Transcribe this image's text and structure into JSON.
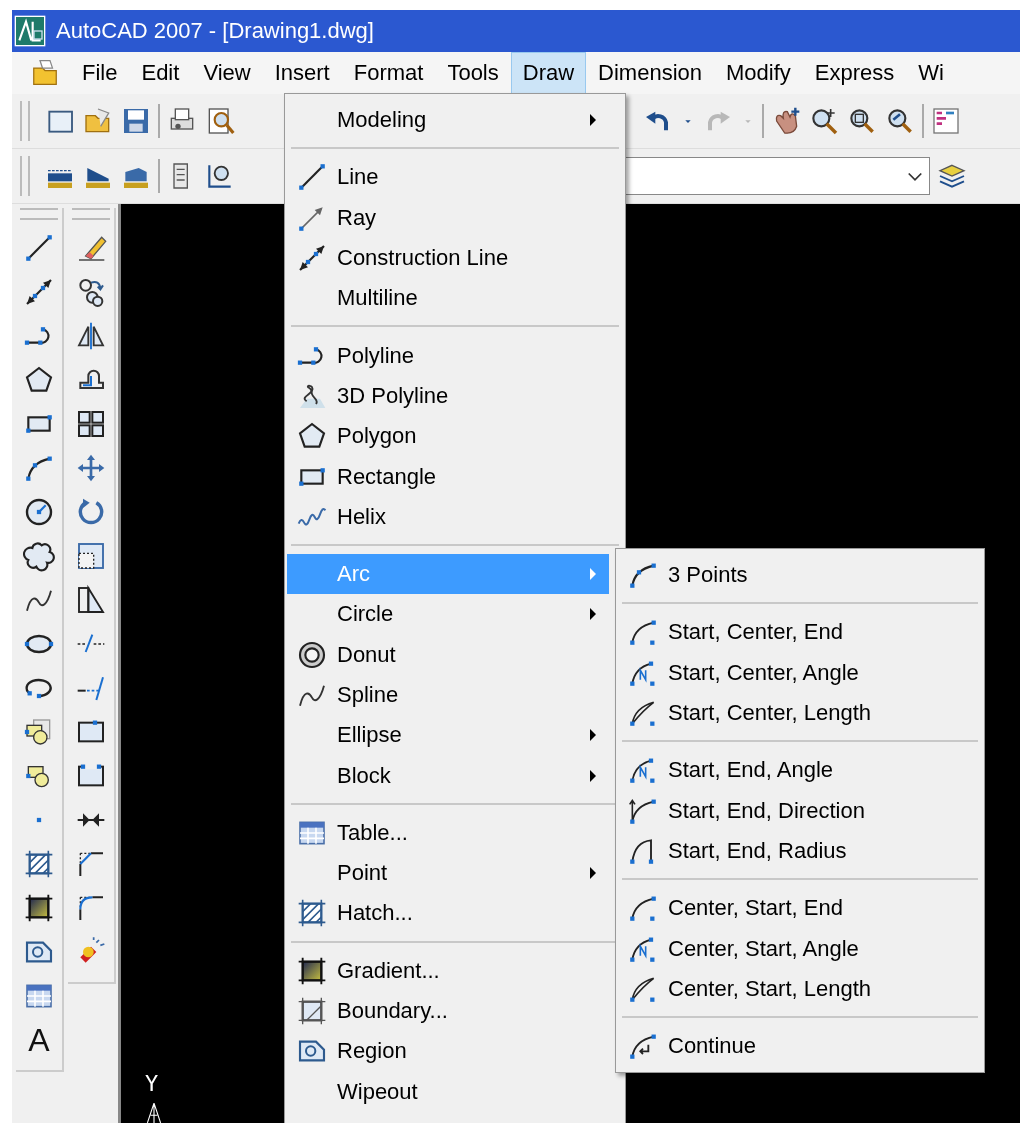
{
  "window": {
    "title": "AutoCAD 2007 - [Drawing1.dwg]"
  },
  "menubar": [
    {
      "label": "File",
      "selected": false
    },
    {
      "label": "Edit",
      "selected": false
    },
    {
      "label": "View",
      "selected": false
    },
    {
      "label": "Insert",
      "selected": false
    },
    {
      "label": "Format",
      "selected": false
    },
    {
      "label": "Tools",
      "selected": false
    },
    {
      "label": "Draw",
      "selected": true
    },
    {
      "label": "Dimension",
      "selected": false
    },
    {
      "label": "Modify",
      "selected": false
    },
    {
      "label": "Express",
      "selected": false
    },
    {
      "label": "Wi",
      "selected": false
    }
  ],
  "draw_toolbar": {
    "text_tool_glyph": "A"
  },
  "ucs_icon": {
    "y_label": "Y"
  },
  "draw_menu": {
    "sections": [
      [
        {
          "label": "Modeling",
          "submenu": true,
          "selected": false
        }
      ],
      [
        {
          "label": "Line",
          "submenu": false,
          "selected": false
        },
        {
          "label": "Ray",
          "submenu": false,
          "selected": false
        },
        {
          "label": "Construction Line",
          "submenu": false,
          "selected": false
        },
        {
          "label": "Multiline",
          "submenu": false,
          "selected": false
        }
      ],
      [
        {
          "label": "Polyline",
          "submenu": false,
          "selected": false
        },
        {
          "label": "3D Polyline",
          "submenu": false,
          "selected": false
        },
        {
          "label": "Polygon",
          "submenu": false,
          "selected": false
        },
        {
          "label": "Rectangle",
          "submenu": false,
          "selected": false
        },
        {
          "label": "Helix",
          "submenu": false,
          "selected": false
        }
      ],
      [
        {
          "label": "Arc",
          "submenu": true,
          "selected": true
        },
        {
          "label": "Circle",
          "submenu": true,
          "selected": false
        },
        {
          "label": "Donut",
          "submenu": false,
          "selected": false
        },
        {
          "label": "Spline",
          "submenu": false,
          "selected": false
        },
        {
          "label": "Ellipse",
          "submenu": true,
          "selected": false
        },
        {
          "label": "Block",
          "submenu": true,
          "selected": false
        }
      ],
      [
        {
          "label": "Table...",
          "submenu": false,
          "selected": false
        },
        {
          "label": "Point",
          "submenu": true,
          "selected": false
        },
        {
          "label": "Hatch...",
          "submenu": false,
          "selected": false
        }
      ],
      [
        {
          "label": "Gradient...",
          "submenu": false,
          "selected": false
        },
        {
          "label": "Boundary...",
          "submenu": false,
          "selected": false
        },
        {
          "label": "Region",
          "submenu": false,
          "selected": false
        },
        {
          "label": "Wipeout",
          "submenu": false,
          "selected": false
        }
      ]
    ]
  },
  "arc_submenu": {
    "sections": [
      [
        {
          "label": "3 Points"
        }
      ],
      [
        {
          "label": "Start, Center, End"
        },
        {
          "label": "Start, Center, Angle"
        },
        {
          "label": "Start, Center, Length"
        }
      ],
      [
        {
          "label": "Start, End, Angle"
        },
        {
          "label": "Start, End, Direction"
        },
        {
          "label": "Start, End, Radius"
        }
      ],
      [
        {
          "label": "Center, Start, End"
        },
        {
          "label": "Center, Start, Angle"
        },
        {
          "label": "Center, Start, Length"
        }
      ],
      [
        {
          "label": "Continue"
        }
      ]
    ]
  }
}
